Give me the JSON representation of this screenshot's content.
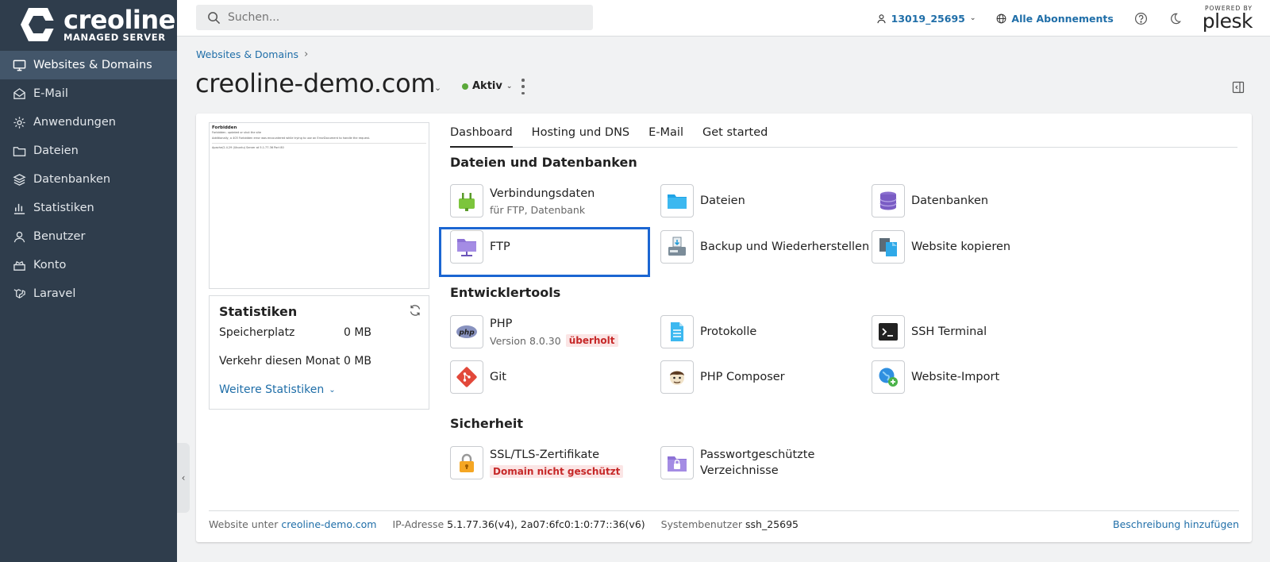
{
  "sidebar": {
    "logo": {
      "title": "creoline",
      "subtitle": "MANAGED SERVER"
    },
    "items": [
      {
        "label": "Websites & Domains",
        "icon": "monitor-icon",
        "active": true
      },
      {
        "label": "E-Mail",
        "icon": "mail-icon"
      },
      {
        "label": "Anwendungen",
        "icon": "gear-icon"
      },
      {
        "label": "Dateien",
        "icon": "folder-icon"
      },
      {
        "label": "Datenbanken",
        "icon": "database-icon"
      },
      {
        "label": "Statistiken",
        "icon": "bar-chart-icon"
      },
      {
        "label": "Benutzer",
        "icon": "user-icon"
      },
      {
        "label": "Konto",
        "icon": "briefcase-icon"
      },
      {
        "label": "Laravel",
        "icon": "laravel-icon"
      }
    ]
  },
  "topbar": {
    "search_placeholder": "Suchen...",
    "user": "13019_25695",
    "subscriptions": "Alle Abonnements",
    "powered_by": "POWERED BY",
    "brand": "plesk"
  },
  "header": {
    "breadcrumb": "Websites & Domains",
    "title": "creoline-demo.com",
    "status": "Aktiv",
    "status_color": "#5ba83a"
  },
  "preview": {
    "title": "Forbidden",
    "lines": [
      "Forbidden. updated or shut the site",
      "Additionally, a 403 Forbidden error was encountered while trying to use an ErrorDocument to handle the request.",
      "Apache/2.4.29 (Ubuntu) Server at 5.1.77.36 Port 80"
    ]
  },
  "stats": {
    "title": "Statistiken",
    "rows": [
      {
        "label": "Speicherplatz",
        "value": "0 MB"
      },
      {
        "label": "Verkehr diesen Monat",
        "value": "0 MB"
      }
    ],
    "more": "Weitere Statistiken"
  },
  "tabs": [
    "Dashboard",
    "Hosting und DNS",
    "E-Mail",
    "Get started"
  ],
  "sections": {
    "files": {
      "title": "Dateien und Datenbanken",
      "items": [
        {
          "name": "Verbindungsdaten",
          "sub": "für FTP, Datenbank",
          "icon": "plug-icon"
        },
        {
          "name": "Dateien",
          "icon": "folder-icon"
        },
        {
          "name": "Datenbanken",
          "icon": "database-icon"
        },
        {
          "name": "FTP",
          "icon": "ftp-folder-icon"
        },
        {
          "name": "Backup und Wiederherstellen",
          "icon": "backup-icon"
        },
        {
          "name": "Website kopieren",
          "icon": "copy-icon"
        }
      ]
    },
    "dev": {
      "title": "Entwicklertools",
      "items": [
        {
          "name": "PHP",
          "sub": "Version 8.0.30",
          "badge": "überholt",
          "icon": "php-icon"
        },
        {
          "name": "Protokolle",
          "icon": "log-icon"
        },
        {
          "name": "SSH Terminal",
          "icon": "terminal-icon"
        },
        {
          "name": "Git",
          "icon": "git-icon"
        },
        {
          "name": "PHP Composer",
          "icon": "composer-icon"
        },
        {
          "name": "Website-Import",
          "icon": "import-icon"
        }
      ]
    },
    "security": {
      "title": "Sicherheit",
      "items": [
        {
          "name": "SSL/TLS-Zertifikate",
          "badge": "Domain nicht geschützt",
          "icon": "lock-icon"
        },
        {
          "name": "Passwortgeschützte",
          "name2": "Verzeichnisse",
          "icon": "protected-folder-icon"
        }
      ]
    }
  },
  "footer": {
    "website_label": "Website unter",
    "website_link": "creoline-demo.com",
    "ip_label": "IP-Adresse",
    "ip_value": "5.1.77.36(v4), 2a07:6fc0:1:0:77::36(v6)",
    "sysuser_label": "Systembenutzer",
    "sysuser_value": "ssh_25695",
    "add_description": "Beschreibung hinzufügen"
  },
  "colors": {
    "sidebar": "#2f3d4c",
    "sidebar_active": "#43566a",
    "link": "#1f6ea8",
    "highlight": "#1b66d2"
  }
}
